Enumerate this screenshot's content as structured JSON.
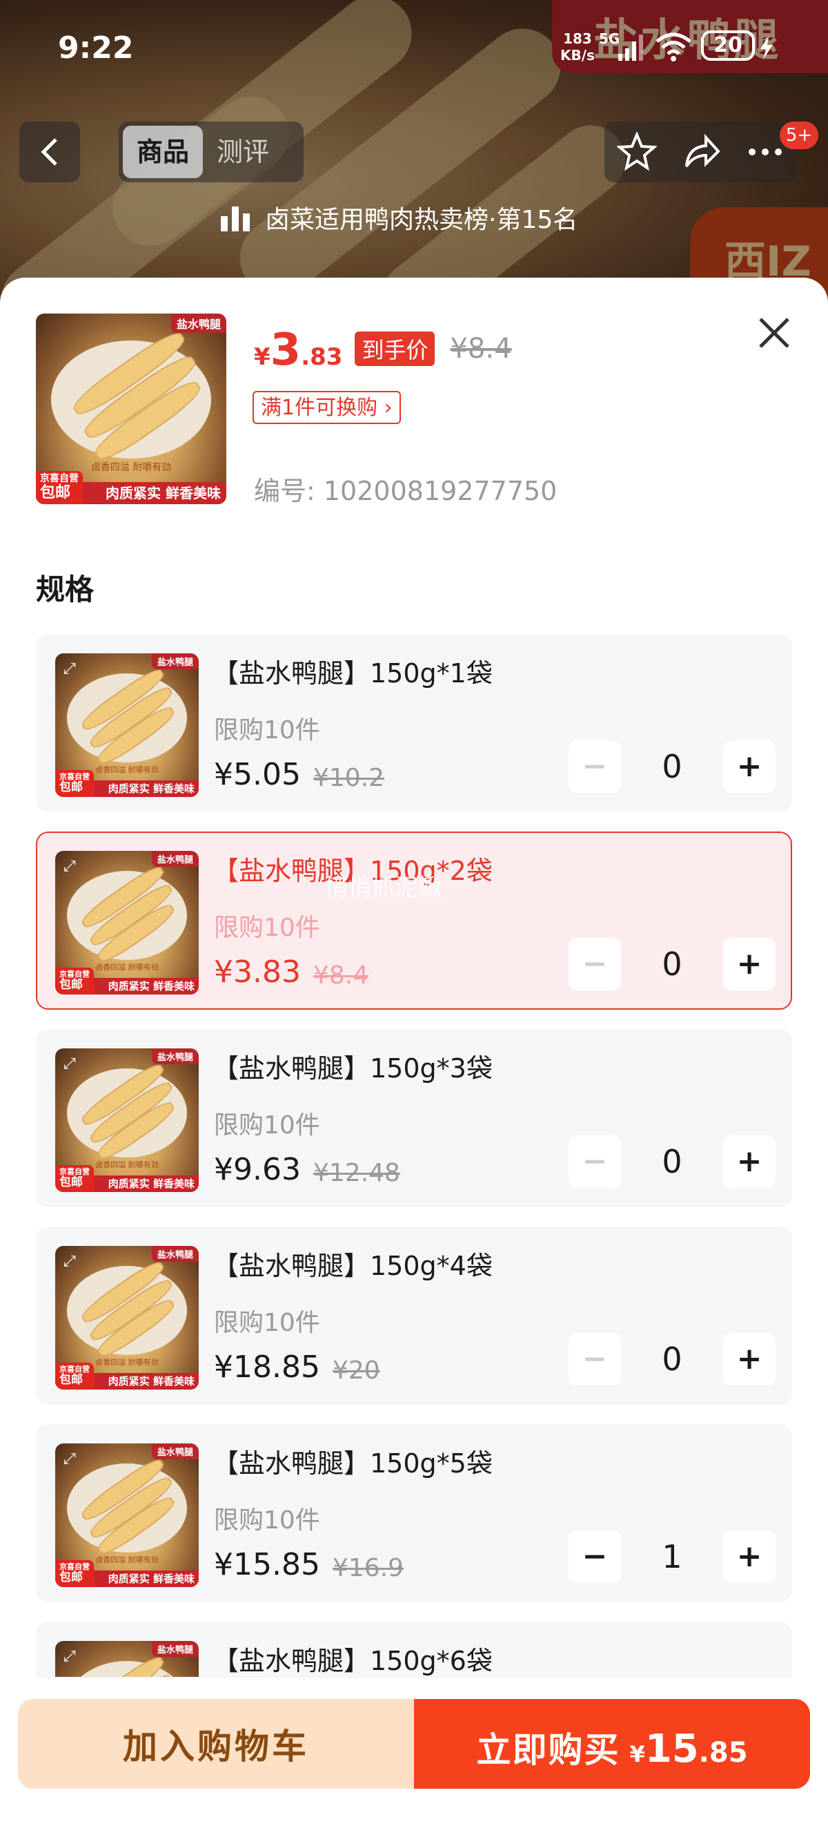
{
  "status_bar": {
    "time": "9:22",
    "net_speed_value": "183",
    "net_speed_unit": "KB/s",
    "network": "5G",
    "battery": "20"
  },
  "hero": {
    "badge_text": "盐水鸭腿",
    "corner_text": "西IZ"
  },
  "nav": {
    "tabs": [
      {
        "label": "商品",
        "active": true
      },
      {
        "label": "测评",
        "active": false
      }
    ],
    "message_badge": "5+",
    "rank_text": "卤菜适用鸭肉热卖榜·第15名"
  },
  "product": {
    "thumb_tag": "盐水鸭腿",
    "thumb_jd_top": "京喜自营",
    "thumb_jd_bottom": "包邮",
    "thumb_slogan": "卤香四溢 耐嚼有劲",
    "thumb_bottom": "肉质紧实 鲜香美味",
    "price_symbol": "¥",
    "price_int": "3",
    "price_dec": ".83",
    "price_tag": "到手价",
    "old_price": "¥8.4",
    "promo": "满1件可换购",
    "sku_no": "编号: 10200819277750"
  },
  "spec_title": "规格",
  "watermark": "悄悄抓泥鳅",
  "skus": [
    {
      "name": "【盐水鸭腿】150g*1袋",
      "limit": "限购10件",
      "price": "¥5.05",
      "old_price": "¥10.2",
      "qty": "0",
      "selected": false
    },
    {
      "name": "【盐水鸭腿】150g*2袋",
      "limit": "限购10件",
      "price": "¥3.83",
      "old_price": "¥8.4",
      "qty": "0",
      "selected": true
    },
    {
      "name": "【盐水鸭腿】150g*3袋",
      "limit": "限购10件",
      "price": "¥9.63",
      "old_price": "¥12.48",
      "qty": "0",
      "selected": false
    },
    {
      "name": "【盐水鸭腿】150g*4袋",
      "limit": "限购10件",
      "price": "¥18.85",
      "old_price": "¥20",
      "qty": "0",
      "selected": false
    },
    {
      "name": "【盐水鸭腿】150g*5袋",
      "limit": "限购10件",
      "price": "¥15.85",
      "old_price": "¥16.9",
      "qty": "1",
      "selected": false
    },
    {
      "name": "【盐水鸭腿】150g*6袋",
      "limit": "",
      "price": "",
      "old_price": "",
      "qty": "",
      "selected": false
    }
  ],
  "bottom": {
    "add_to_cart": "加入购物车",
    "buy_now": "立即购买",
    "buy_symbol": "¥",
    "buy_int": "15",
    "buy_dec": ".85"
  },
  "colors": {
    "accent": "#e6372b",
    "buy_button": "#f5421c",
    "cart_button": "#fde1c6",
    "selected_card_bg": "#fdecee"
  }
}
